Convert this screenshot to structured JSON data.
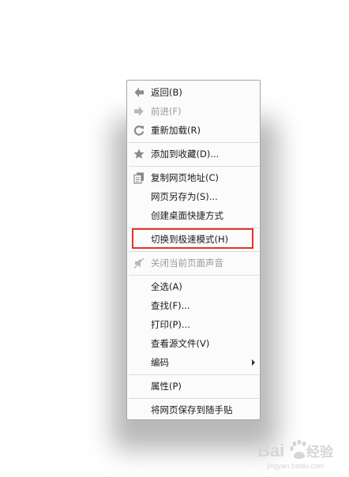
{
  "menu": {
    "items": [
      {
        "id": "back",
        "label": "返回(B)",
        "icon": "back-arrow-icon",
        "enabled": true
      },
      {
        "id": "forward",
        "label": "前进(F)",
        "icon": "forward-arrow-icon",
        "enabled": false
      },
      {
        "id": "reload",
        "label": "重新加载(R)",
        "icon": "reload-icon",
        "enabled": true
      },
      {
        "id": "bookmark",
        "label": "添加到收藏(D)...",
        "icon": "star-icon",
        "enabled": true
      },
      {
        "id": "copy-url",
        "label": "复制网页地址(C)",
        "icon": "copy-icon",
        "enabled": true
      },
      {
        "id": "save-as",
        "label": "网页另存为(S)...",
        "enabled": true
      },
      {
        "id": "desktop-shortcut",
        "label": "创建桌面快捷方式",
        "enabled": true
      },
      {
        "id": "switch-mode",
        "label": "切换到极速模式(H)",
        "enabled": true,
        "highlighted": true
      },
      {
        "id": "mute-page",
        "label": "关闭当前页面声音",
        "icon": "mute-icon",
        "enabled": false
      },
      {
        "id": "select-all",
        "label": "全选(A)",
        "enabled": true
      },
      {
        "id": "find",
        "label": "查找(F)...",
        "enabled": true
      },
      {
        "id": "print",
        "label": "打印(P)...",
        "enabled": true
      },
      {
        "id": "view-source",
        "label": "查看源文件(V)",
        "enabled": true
      },
      {
        "id": "encoding",
        "label": "编码",
        "enabled": true,
        "submenu": true
      },
      {
        "id": "properties",
        "label": "属性(P)",
        "enabled": true
      },
      {
        "id": "save-to-notes",
        "label": "将网页保存到随手贴",
        "enabled": true
      }
    ]
  },
  "watermark": {
    "brand": "Baidu",
    "product": "经验",
    "url": "jingyan.baidu.com"
  },
  "colors": {
    "highlight_border": "#e8312a",
    "menu_background": "#fbfbfb",
    "separator": "#dcdcdc",
    "disabled_text": "#9a9a9a"
  }
}
